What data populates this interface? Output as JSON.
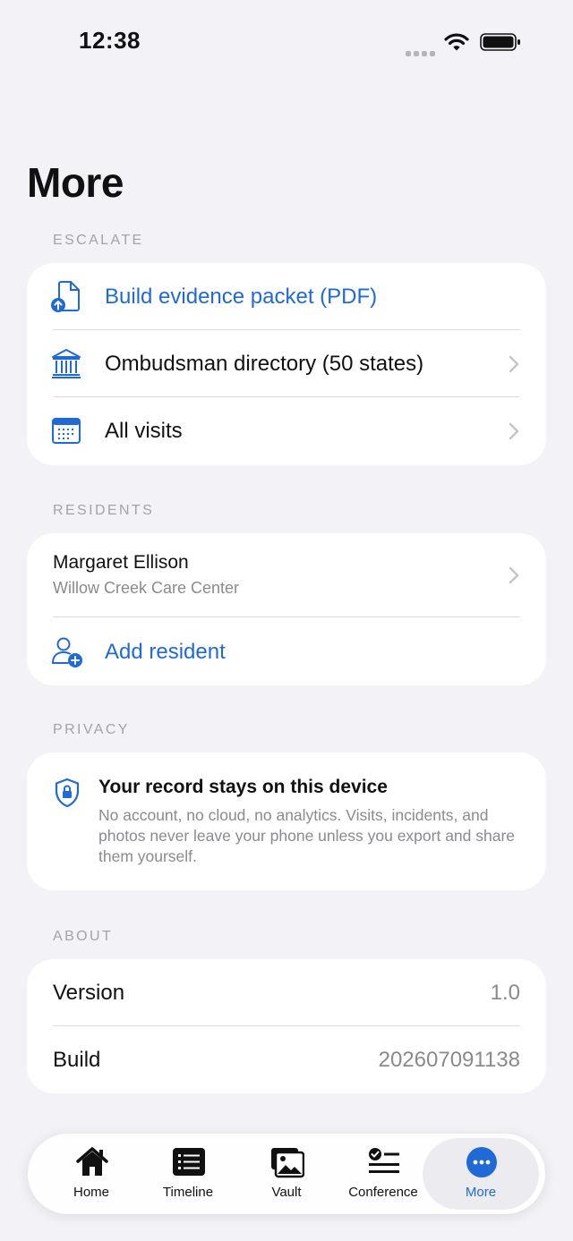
{
  "status_bar": {
    "time": "12:38"
  },
  "page_title": "More",
  "escalate": {
    "section_label": "ESCALATE",
    "items": [
      {
        "label": "Build evidence packet (PDF)",
        "icon": "document-upload-icon"
      },
      {
        "label": "Ombudsman directory (50 states)",
        "icon": "bank-building-icon"
      },
      {
        "label": "All visits",
        "icon": "calendar-icon"
      }
    ]
  },
  "residents": {
    "section_label": "RESIDENTS",
    "resident": {
      "name": "Margaret Ellison",
      "facility": "Willow Creek Care Center"
    },
    "add_label": "Add resident"
  },
  "privacy": {
    "section_label": "PRIVACY",
    "title": "Your record stays on this device",
    "body": "No account, no cloud, no analytics. Visits, incidents, and photos never leave your phone unless you export and share them yourself."
  },
  "about": {
    "section_label": "ABOUT",
    "rows": [
      {
        "label": "Version",
        "value": "1.0"
      },
      {
        "label": "Build",
        "value": "202607091138"
      }
    ]
  },
  "tab_bar": {
    "tabs": [
      {
        "label": "Home",
        "icon": "house-icon"
      },
      {
        "label": "Timeline",
        "icon": "list-icon"
      },
      {
        "label": "Vault",
        "icon": "photos-icon"
      },
      {
        "label": "Conference",
        "icon": "checklist-icon"
      },
      {
        "label": "More",
        "icon": "ellipsis-icon"
      }
    ],
    "active": "More"
  },
  "colors": {
    "accent": "#1f6ad6",
    "background": "#f2f2f7",
    "secondary_text": "#8a8a8f"
  }
}
